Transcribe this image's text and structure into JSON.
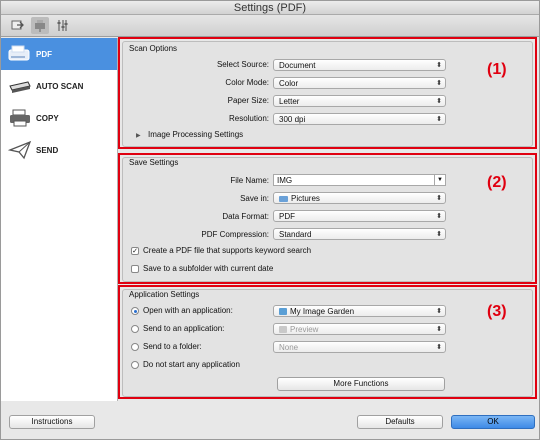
{
  "window": {
    "title": "Settings (PDF)"
  },
  "toolbar": {
    "tabs": [
      "scan-from-computer-icon",
      "scan-from-panel-icon",
      "general-settings-icon"
    ]
  },
  "sidebar": {
    "items": [
      {
        "label": "PDF",
        "icon": "pdf-scanner-icon",
        "active": true
      },
      {
        "label": "AUTO SCAN",
        "icon": "scanner-icon",
        "active": false
      },
      {
        "label": "COPY",
        "icon": "printer-icon",
        "active": false
      },
      {
        "label": "SEND",
        "icon": "paper-plane-icon",
        "active": false
      }
    ]
  },
  "scan_options": {
    "title": "Scan Options",
    "source_label": "Select Source:",
    "source_value": "Document",
    "color_label": "Color Mode:",
    "color_value": "Color",
    "paper_label": "Paper Size:",
    "paper_value": "Letter",
    "resolution_label": "Resolution:",
    "resolution_value": "300 dpi",
    "image_processing": "Image Processing Settings",
    "marker": "(1)"
  },
  "save_settings": {
    "title": "Save Settings",
    "filename_label": "File Name:",
    "filename_value": "IMG",
    "savein_label": "Save in:",
    "savein_value": "Pictures",
    "format_label": "Data Format:",
    "format_value": "PDF",
    "compression_label": "PDF Compression:",
    "compression_value": "Standard",
    "keyword_search": "Create a PDF file that supports keyword search",
    "keyword_checked": true,
    "subfolder": "Save to a subfolder with current date",
    "subfolder_checked": false,
    "marker": "(2)"
  },
  "app_settings": {
    "title": "Application Settings",
    "open_app_label": "Open with an application:",
    "open_app_value": "My Image Garden",
    "send_app_label": "Send to an application:",
    "send_app_value": "Preview",
    "send_folder_label": "Send to a folder:",
    "send_folder_value": "None",
    "no_app_label": "Do not start any application",
    "selected": "open_app",
    "more_functions": "More Functions",
    "marker": "(3)"
  },
  "footer": {
    "instructions": "Instructions",
    "defaults": "Defaults",
    "ok": "OK"
  },
  "colors": {
    "accent": "#4a90e0",
    "highlight": "#e00010"
  }
}
